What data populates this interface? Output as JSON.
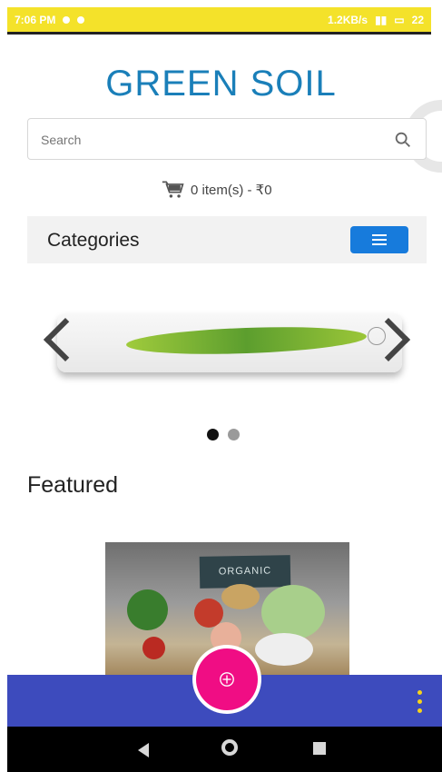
{
  "status_bar": {
    "time": "7:06 PM",
    "network_speed": "1.2KB/s",
    "battery": "22"
  },
  "header": {
    "brand": "GREEN SOIL"
  },
  "search": {
    "placeholder": "Search"
  },
  "cart": {
    "summary": "0 item(s) - ₹0"
  },
  "categories": {
    "label": "Categories"
  },
  "featured": {
    "heading": "Featured",
    "product_sign": "ORGANIC"
  },
  "icons": {
    "search": "search-icon",
    "cart": "cart-icon",
    "menu": "menu-icon",
    "add": "add-icon",
    "more": "more-vert-icon",
    "back": "back-icon",
    "home": "home-icon",
    "recent": "recent-apps-icon"
  },
  "colors": {
    "brand": "#1a7fb9",
    "status_bar": "#f4e22a",
    "menu_button": "#177bdc",
    "bottom_bar": "#3d4bbd",
    "fab": "#f00d84",
    "overflow": "#f6d31b"
  },
  "slider": {
    "active_index": 1,
    "total": 2
  }
}
